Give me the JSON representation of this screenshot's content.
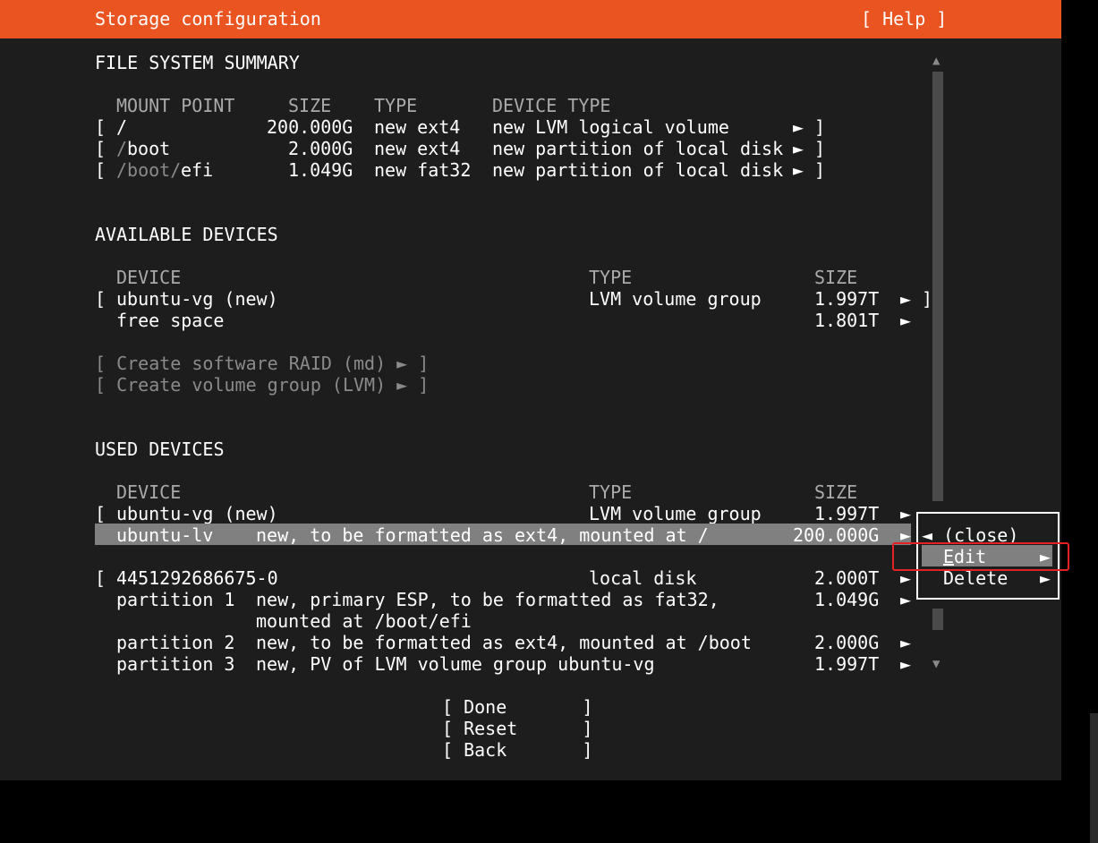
{
  "header": {
    "title": "Storage configuration",
    "help": "[ Help ]"
  },
  "fs_summary": {
    "title": "FILE SYSTEM SUMMARY",
    "columns": [
      "MOUNT POINT",
      "SIZE",
      "TYPE",
      "DEVICE TYPE"
    ],
    "rows": [
      {
        "open": "[",
        "mount": "/",
        "mount_dim": "",
        "size": "200.000G",
        "type": "new ext4",
        "device_type": "new LVM logical volume",
        "arrow": "►",
        "close": "]"
      },
      {
        "open": "[",
        "mount": "boot",
        "mount_dim": "/",
        "size": "2.000G",
        "type": "new ext4",
        "device_type": "new partition of local disk",
        "arrow": "►",
        "close": "]"
      },
      {
        "open": "[",
        "mount": "efi",
        "mount_dim": "/boot/",
        "size": "1.049G",
        "type": "new fat32",
        "device_type": "new partition of local disk",
        "arrow": "►",
        "close": "]"
      }
    ]
  },
  "available": {
    "title": "AVAILABLE DEVICES",
    "columns": [
      "DEVICE",
      "TYPE",
      "SIZE"
    ],
    "rows": [
      {
        "open": "[",
        "device": "ubuntu-vg (new)",
        "type": "LVM volume group",
        "size": "1.997T",
        "arrow": "►",
        "close": "]"
      },
      {
        "device": "free space",
        "size": "1.801T",
        "arrow": "►"
      }
    ],
    "actions": [
      "[ Create software RAID (md) ► ]",
      "[ Create volume group (LVM) ► ]"
    ]
  },
  "used": {
    "title": "USED DEVICES",
    "columns": [
      "DEVICE",
      "TYPE",
      "SIZE"
    ],
    "rows": [
      {
        "open": "[",
        "device": "ubuntu-vg (new)",
        "type": "LVM volume group",
        "size": "1.997T",
        "arrow": "►"
      },
      {
        "device": "ubuntu-lv",
        "desc": "new, to be formatted as ext4, mounted at /",
        "size": "200.000G",
        "arrow": "►"
      },
      {
        "open": "[",
        "device": "4451292686675-0",
        "type": "local disk",
        "size": "2.000T",
        "arrow": "►"
      },
      {
        "device": "partition 1",
        "desc": "new, primary ESP, to be formatted as fat32,",
        "desc2": "mounted at /boot/efi",
        "size": "1.049G",
        "arrow": "►"
      },
      {
        "device": "partition 2",
        "desc": "new, to be formatted as ext4, mounted at /boot",
        "size": "2.000G",
        "arrow": "►"
      },
      {
        "device": "partition 3",
        "desc": "new, PV of LVM volume group ubuntu-vg",
        "size": "1.997T",
        "arrow": "►"
      }
    ]
  },
  "buttons": [
    "[ Done       ]",
    "[ Reset      ]",
    "[ Back       ]"
  ],
  "context_menu": {
    "close": "◄ (close)",
    "edit_first": "E",
    "edit_rest": "dit",
    "edit_arrow": "►",
    "delete": "Delete",
    "delete_arrow": "►"
  },
  "scrollbar": {
    "up": "▲",
    "down": "▼"
  },
  "colors": {
    "header": "#e95420",
    "background": "#1d1d1d",
    "selection": "#808080",
    "annotation": "#e52222"
  }
}
